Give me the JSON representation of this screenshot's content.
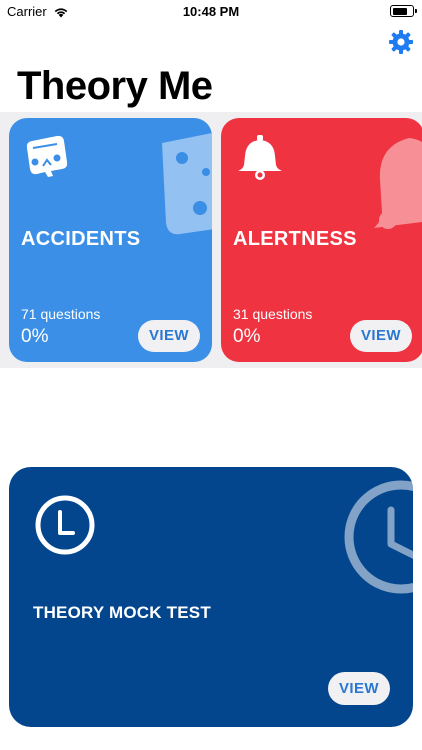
{
  "status_bar": {
    "carrier": "Carrier",
    "time": "10:48 PM",
    "battery_level": 0.8,
    "wifi_icon": "wifi-icon",
    "battery_icon": "battery-icon"
  },
  "header": {
    "settings_icon": "gear-icon",
    "title": "Theory Me"
  },
  "categories": [
    {
      "title": "ACCIDENTS",
      "questions": "71 questions",
      "progress": "0%",
      "view_label": "VIEW",
      "icon": "car-crash-icon",
      "color": "#3b8fe6",
      "button_text_color": "#2a78d2"
    },
    {
      "title": "ALERTNESS",
      "questions": "31 questions",
      "progress": "0%",
      "view_label": "VIEW",
      "icon": "bell-icon",
      "color": "#ef3340",
      "button_text_color": "#2a78d2"
    }
  ],
  "mock_test": {
    "title": "THEORY MOCK TEST",
    "view_label": "VIEW",
    "icon": "clock-icon",
    "color": "#04468e",
    "button_text_color": "#2a78d2"
  },
  "colors": {
    "accent": "#1e7bf2",
    "strip_background": "#efeff2",
    "text": "#000000"
  }
}
